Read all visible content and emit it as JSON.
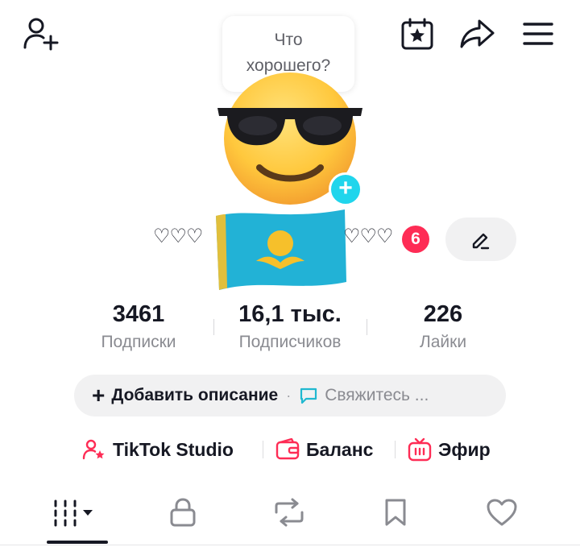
{
  "header": {
    "add_friend_icon": "person-plus-icon",
    "calendar_icon": "calendar-star-icon",
    "share_icon": "share-arrow-icon",
    "menu_icon": "hamburger-menu-icon"
  },
  "status_bubble": {
    "line1": "Что",
    "line2": "хорошего?"
  },
  "profile": {
    "avatar_icon": "sunglasses-emoji-avatar",
    "flag_icon": "kazakhstan-flag-icon",
    "name_left": "♡♡♡",
    "name_right": "♡♡♡",
    "notification_count": "6"
  },
  "stats": {
    "following": {
      "value": "3461",
      "label": "Подписки"
    },
    "followers": {
      "value": "16,1 тыс.",
      "label": "Подписчиков"
    },
    "likes": {
      "value": "226",
      "label": "Лайки"
    }
  },
  "description": {
    "add_label": "Добавить описание",
    "separator": "·",
    "contact_label": "Свяжитесь ..."
  },
  "links": {
    "studio": "TikTok Studio",
    "balance": "Баланс",
    "live": "Эфир"
  },
  "tabs": [
    "videos-grid-icon",
    "lock-icon",
    "repost-icon",
    "bookmark-icon",
    "heart-icon"
  ],
  "colors": {
    "accent_pink": "#fe2c55",
    "accent_cyan": "#20d5ec",
    "text_primary": "#161823",
    "text_secondary": "#8a8b91",
    "pill_bg": "#f1f1f2"
  }
}
